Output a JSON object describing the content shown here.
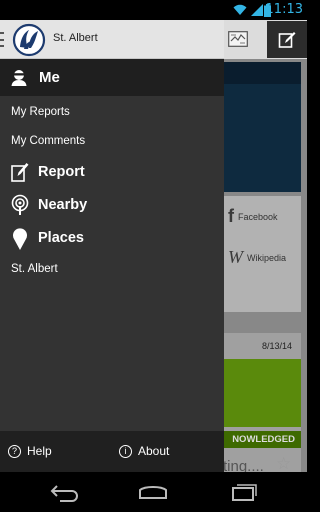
{
  "status_bar": {
    "time": "11:13",
    "icons": [
      "wifi-icon",
      "signal-icon",
      "battery-icon"
    ],
    "time_color": "#33b5e5"
  },
  "header": {
    "app_title": "St. Albert"
  },
  "drawer": {
    "me_label": "Me",
    "items": [
      {
        "label": "My Reports",
        "icon": null
      },
      {
        "label": "My Comments",
        "icon": null
      },
      {
        "label": "Report",
        "icon": "edit-icon"
      },
      {
        "label": "Nearby",
        "icon": "nearby-icon"
      },
      {
        "label": "Places",
        "icon": "map-pin-icon"
      },
      {
        "label": "St. Albert",
        "icon": null
      }
    ],
    "footer": {
      "help_label": "Help",
      "about_label": "About"
    }
  },
  "background": {
    "facebook_label": "Facebook",
    "wikipedia_label": "Wikipedia",
    "date": "8/13/14",
    "status_text": "NOWLEDGED",
    "listing_fragment": "ting...."
  },
  "colors": {
    "drawer_bg": "#333333",
    "drawer_header_bg": "#1f1f1f",
    "accent": "#33b5e5",
    "status_green": "#5a8a0c"
  }
}
